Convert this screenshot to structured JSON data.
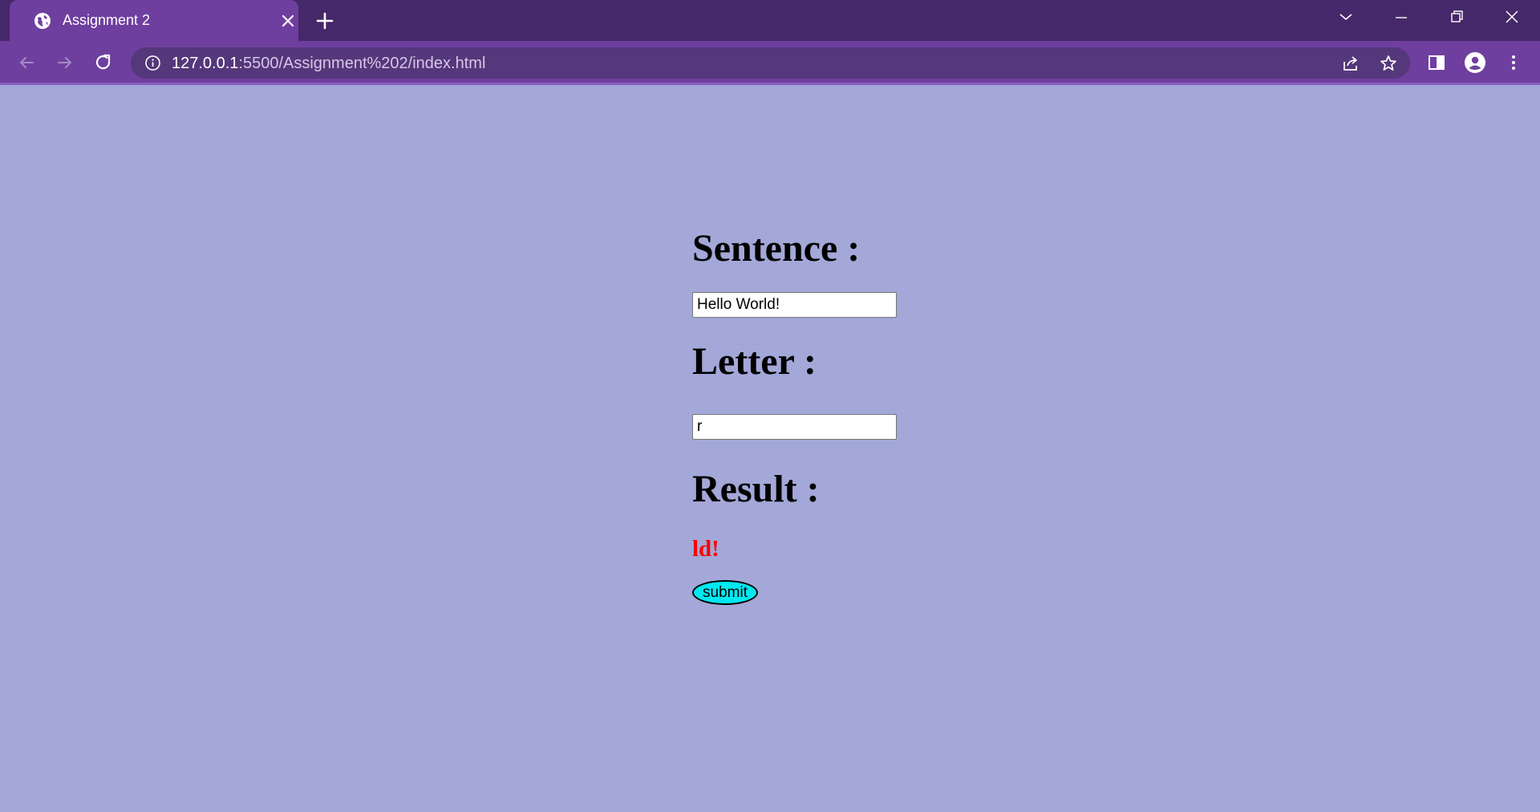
{
  "browser": {
    "tab": {
      "title": "Assignment 2",
      "favicon": "globe-icon"
    },
    "address_bar": {
      "host": "127.0.0.1",
      "path": ":5500/Assignment%202/index.html"
    },
    "colors": {
      "tabstrip": "#452869",
      "toolbar": "#6e3f9f",
      "omnibox": "#55377b",
      "page_background": "#a3a8d8"
    }
  },
  "page": {
    "sentence_heading": "Sentence :",
    "sentence_value": "Hello World!",
    "letter_heading": "Letter :",
    "letter_value": "r",
    "result_heading": "Result :",
    "result_value": "ld!",
    "submit_label": "submit",
    "colors": {
      "result_text": "#ff0000",
      "submit_background": "#00e8f0"
    }
  }
}
